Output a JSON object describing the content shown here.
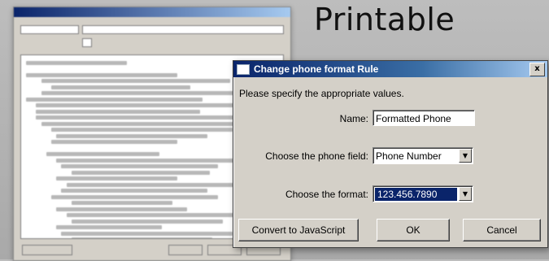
{
  "heading": "Printable",
  "dialog": {
    "title": "Change phone format Rule",
    "close_label": "x",
    "prompt": "Please specify the appropriate values.",
    "name_label": "Name:",
    "name_value": "Formatted Phone",
    "field_label": "Choose the phone field:",
    "field_value": "Phone Number",
    "format_label": "Choose the format:",
    "format_value": "123.456.7890",
    "convert_label": "Convert to JavaScript",
    "ok_label": "OK",
    "cancel_label": "Cancel"
  },
  "icons": {
    "close": "close-icon",
    "dropdown": "chevron-down-icon"
  },
  "colors": {
    "titlebar": "#0a246a",
    "selection": "#0a246a",
    "dialog_bg": "#d4d0c8"
  }
}
